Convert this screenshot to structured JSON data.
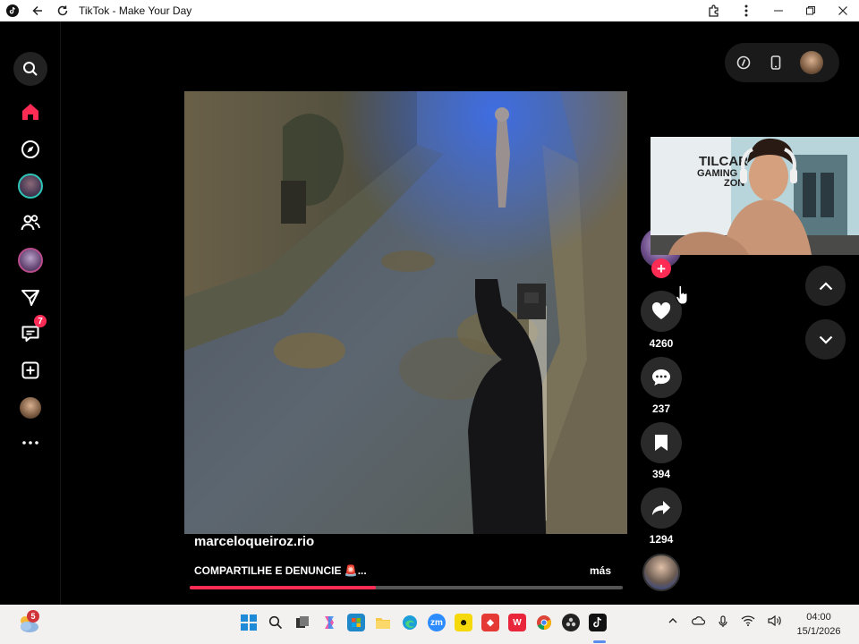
{
  "window": {
    "title": "TikTok - Make Your Day"
  },
  "sidebar": {
    "messages_badge": "7"
  },
  "post": {
    "author": "marceloqueiroz.rio",
    "caption": "COMPARTILHE E DENUNCIE 🚨...",
    "more_label": "más",
    "progress_fraction": 0.43
  },
  "actions": {
    "likes": "4260",
    "comments": "237",
    "saves": "394",
    "shares": "1294"
  },
  "webcam": {
    "sign_line1": "TILCAR",
    "sign_line2": "GAMING",
    "sign_line3": "ZON"
  },
  "taskbar": {
    "weather_badge": "5",
    "time": "04:00",
    "date": "15/1/2026"
  },
  "colors": {
    "accent": "#fe2c55",
    "background": "#000000",
    "taskbar": "#f3f0f0"
  }
}
